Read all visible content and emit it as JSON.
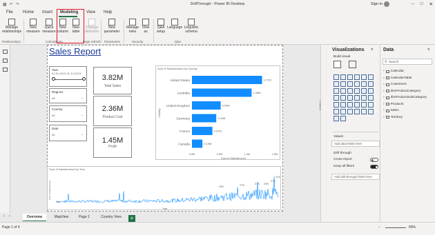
{
  "window": {
    "title": "DrillThrough - Power BI Desktop",
    "user": "Sign in"
  },
  "menu": {
    "tabs": [
      "File",
      "Home",
      "Insert",
      "Modeling",
      "View",
      "Help"
    ],
    "active": "Modeling"
  },
  "ribbon": {
    "buttons": [
      {
        "label": "Manage relationships",
        "name": "manage-relationships-button"
      },
      {
        "label": "New measure",
        "name": "new-measure-button"
      },
      {
        "label": "Quick measure",
        "name": "quick-measure-button"
      },
      {
        "label": "New column",
        "name": "new-column-button"
      },
      {
        "label": "New table",
        "name": "new-table-button"
      },
      {
        "label": "Change detection",
        "name": "change-detection-button",
        "disabled": true
      },
      {
        "label": "New parameter",
        "name": "new-parameter-button"
      },
      {
        "label": "Manage roles",
        "name": "manage-roles-button"
      },
      {
        "label": "View as",
        "name": "view-as-button"
      },
      {
        "label": "Q&A setup",
        "name": "qa-setup-button"
      },
      {
        "label": "Language",
        "name": "language-button"
      },
      {
        "label": "Linguistic schema",
        "name": "linguistic-schema-button"
      }
    ],
    "groups": [
      "Relationships",
      "Calculations",
      "Page refresh",
      "Parameters",
      "Security",
      "Q&A"
    ]
  },
  "report": {
    "title": "Sales Report",
    "slicers": [
      {
        "label": "Year",
        "value": "01-01-2013    31-12-2013"
      },
      {
        "label": "Regions",
        "value": "All"
      },
      {
        "label": "Country",
        "value": "All"
      },
      {
        "label": "Date",
        "value": "All"
      }
    ],
    "cards": [
      {
        "value": "3.82M",
        "caption": "Total Sales"
      },
      {
        "value": "2.36M",
        "caption": "Product Cost"
      },
      {
        "value": "1.45M",
        "caption": "Profit"
      }
    ],
    "bar_chart_title": "Sum of SalesAmount by Country",
    "line_chart_title": "Sum of SalesAmount by Year"
  },
  "chart_data": [
    {
      "type": "bar",
      "title": "Sum of SalesAmount by Country",
      "categories": [
        "United States",
        "Australia",
        "United Kingdom",
        "Germany",
        "France",
        "Canada"
      ],
      "values": [
        1.27,
        1.08,
        0.52,
        0.44,
        0.37,
        0.19
      ],
      "value_labels": [
        "1.27M",
        "1.08M",
        "0.52M",
        "0.44M",
        "0.37M",
        "0.19M"
      ],
      "xlabel": "Sum of SalesAmount",
      "ylabel": "Country",
      "xticks": [
        "0.0M",
        "0.5M",
        "1.0M",
        "1.5M"
      ],
      "xlim": [
        0,
        1.5
      ],
      "color": "#118dff"
    },
    {
      "type": "line",
      "title": "Sum of SalesAmount by Year",
      "xlabel": "Year",
      "ylabel": "Sum of SalesAmount",
      "color": "#118dff",
      "peak_labels": [
        "3K",
        "29K",
        "27K",
        "27K",
        "29K",
        "37K",
        "41K"
      ]
    }
  ],
  "visualizations": {
    "title": "Visualizations",
    "build_visual": "Build visual",
    "values_label": "Values",
    "values_placeholder": "Add data fields here",
    "drill_through_label": "Drill through",
    "cross_report": "Cross-report",
    "cross_report_state": "Off",
    "keep_all_filters": "Keep all filters",
    "keep_all_filters_state": "On",
    "drill_placeholder": "Add drill-through fields here"
  },
  "filters": {
    "label": "Filters"
  },
  "data": {
    "title": "Data",
    "search_placeholder": "Search",
    "tables": [
      "Calendar",
      "CalendarTable",
      "Customers",
      "dimProductCategory",
      "dimProductSubCategory",
      "Products",
      "Sales",
      "Territory"
    ]
  },
  "pages": {
    "tabs": [
      "Overview",
      "MapView",
      "Page 1",
      "Country View"
    ],
    "active": "Overview"
  },
  "status": {
    "page": "Page 1 of 4",
    "zoom": "65%"
  }
}
